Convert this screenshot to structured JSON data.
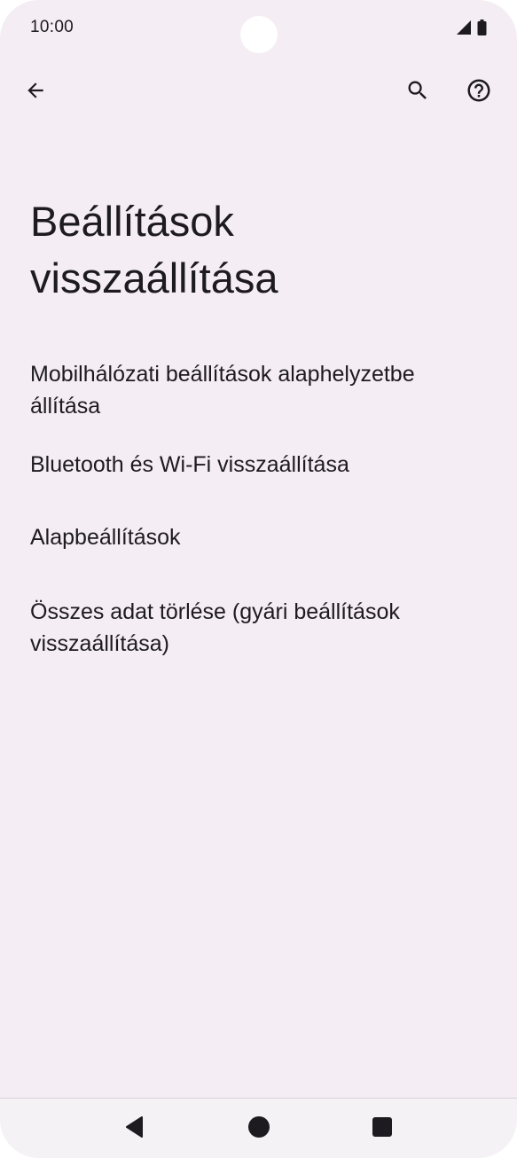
{
  "status_bar": {
    "time": "10:00",
    "icons": [
      "signal-icon",
      "battery-icon"
    ]
  },
  "toolbar": {
    "icons": [
      "back-arrow-icon",
      "search-icon",
      "help-icon"
    ]
  },
  "page": {
    "title_line1": "Beállítások",
    "title_line2": "visszaállítása"
  },
  "menu": {
    "items": [
      {
        "label": "Mobilhálózati beállítások alaphelyzetbe állítása"
      },
      {
        "label": "Bluetooth és Wi-Fi visszaállítása"
      },
      {
        "label": "Alapbeállítások"
      },
      {
        "label": "Összes adat törlése (gyári beállítások visszaállítása)"
      }
    ]
  },
  "navigation_bar": {
    "icons": [
      "nav-back-icon",
      "nav-home-icon",
      "nav-recents-icon"
    ]
  },
  "colors": {
    "background": "#f4edf3",
    "text": "#1d1b20",
    "nav_bar": "#f5f2f5"
  }
}
